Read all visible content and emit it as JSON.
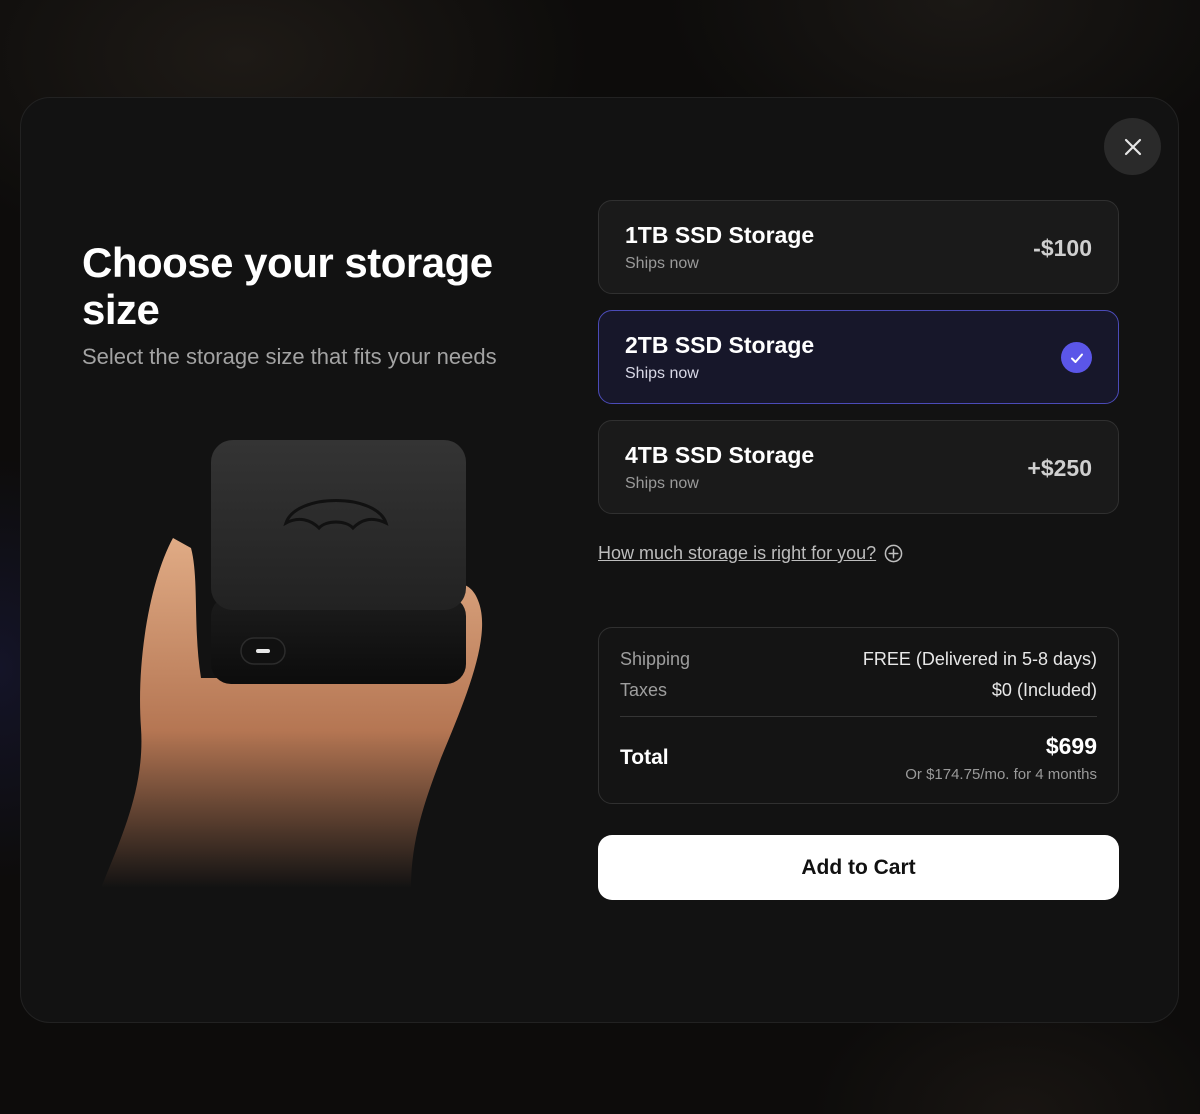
{
  "colors": {
    "modal_bg": "#121212",
    "accent": "#5b56e8",
    "selected_border": "#4b4bb8",
    "cta_bg": "#ffffff"
  },
  "heading": "Choose your storage size",
  "subheading": "Select the storage size that fits your needs",
  "close_icon": "close-icon",
  "options": [
    {
      "title": "1TB SSD Storage",
      "subtitle": "Ships now",
      "price": "-$100",
      "selected": false
    },
    {
      "title": "2TB SSD Storage",
      "subtitle": "Ships now",
      "price": "",
      "selected": true
    },
    {
      "title": "4TB SSD Storage",
      "subtitle": "Ships now",
      "price": "+$250",
      "selected": false
    }
  ],
  "help_link": {
    "label": "How much storage is right for you?",
    "icon": "plus-circle-icon"
  },
  "summary": {
    "shipping_label": "Shipping",
    "shipping_value": "FREE (Delivered in 5-8 days)",
    "taxes_label": "Taxes",
    "taxes_value": "$0 (Included)",
    "total_label": "Total",
    "total_value": "$699",
    "installment": "Or $174.75/mo. for 4 months"
  },
  "cta_label": "Add to Cart"
}
